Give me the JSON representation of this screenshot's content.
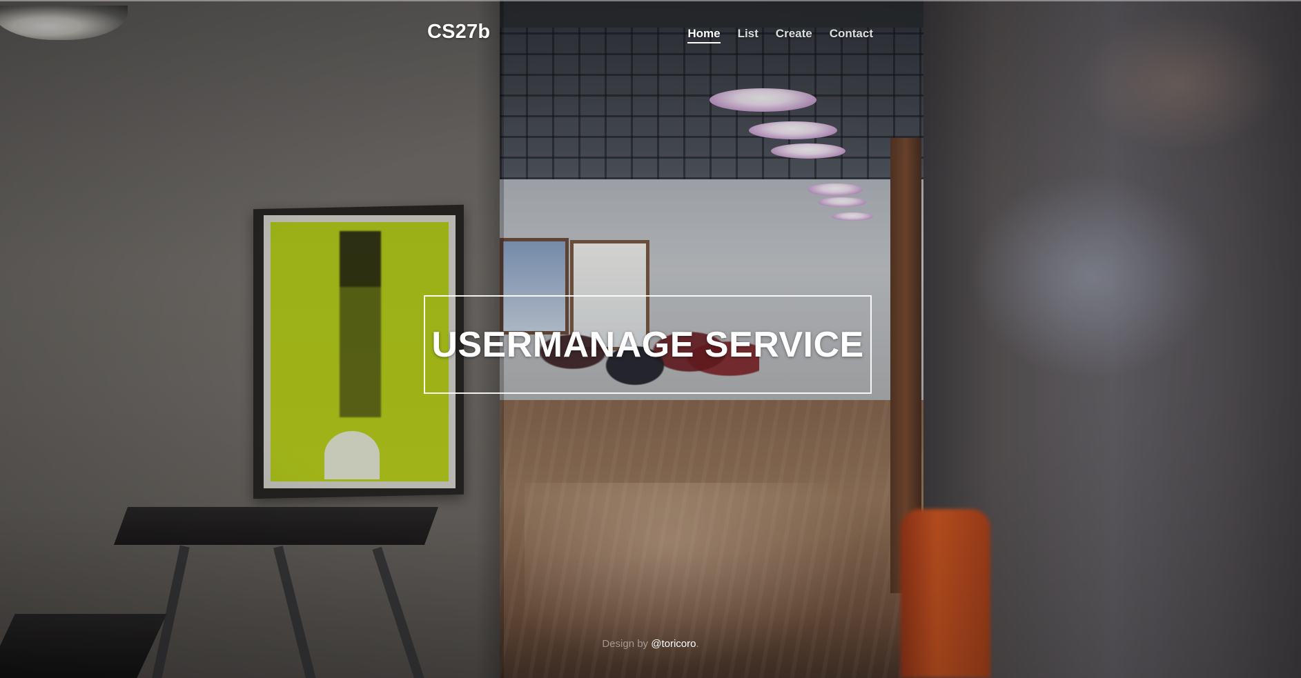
{
  "brand": {
    "name": "CS27b"
  },
  "nav": {
    "items": [
      {
        "label": "Home",
        "active": true
      },
      {
        "label": "List",
        "active": false
      },
      {
        "label": "Create",
        "active": false
      },
      {
        "label": "Contact",
        "active": false
      }
    ]
  },
  "hero": {
    "title": "USERMANAGE SERVICE"
  },
  "footer": {
    "prefix": "Design by ",
    "author": "@toricoro",
    "suffix": "."
  },
  "colors": {
    "text": "#ffffff",
    "hero_border": "#ffffff",
    "footer_muted": "#8a8a8a"
  }
}
